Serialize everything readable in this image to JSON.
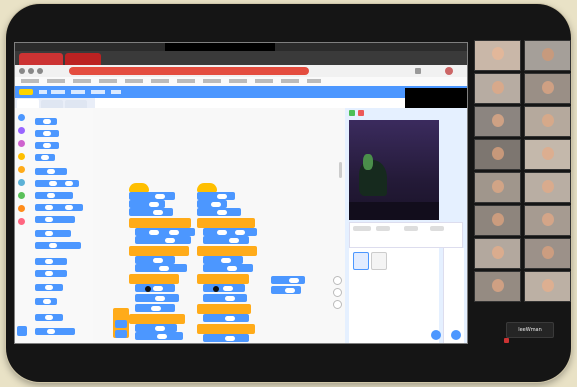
{
  "window": {
    "os_bar_text": "",
    "tabs": [
      "",
      ""
    ],
    "url_text": "",
    "bookmarks": [
      "",
      "",
      "",
      "",
      "",
      "",
      "",
      "",
      ""
    ],
    "scratch_menu": [
      "",
      "",
      ""
    ],
    "subtabs": [
      "",
      "",
      ""
    ]
  },
  "meeting": {
    "name_button": "leeWman"
  },
  "colors": {
    "motion": "#4c97ff",
    "looks": "#9966ff",
    "sound": "#cf63cf",
    "events": "#ffbf00",
    "control": "#ffab19",
    "sensing": "#5cb1d6",
    "operators": "#59c059",
    "variables": "#ff8c1a",
    "myblocks": "#ff6680",
    "url_bar": "#e44d3f",
    "scratch_blue": "#4c97ff"
  }
}
